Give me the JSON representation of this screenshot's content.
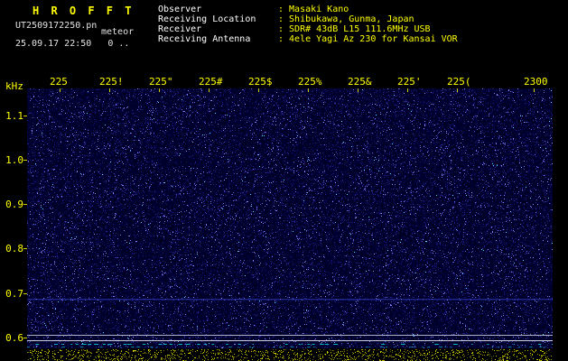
{
  "app": {
    "title": "H R O F F T"
  },
  "header": {
    "filename": "UT2509172250.pn",
    "station": "meteor",
    "datetime": "25.09.17 22:50   0 ..",
    "info_rows": [
      {
        "label": "Observer",
        "value": ": Masaki Kano"
      },
      {
        "label": "Receiving Location",
        "value": ": Shibukawa, Gunma, Japan"
      },
      {
        "label": "Receiver",
        "value": ": SDR# 43dB L15 111.6MHz USB"
      },
      {
        "label": "Receiving Antenna",
        "value": ": 4ele Yagi Az 230 for Kansai VOR"
      }
    ]
  },
  "chart_data": {
    "type": "heatmap",
    "subtype": "radio spectrogram (HROFFT meteor radio observation output)",
    "title": "10-minute meteor echo spectrogram",
    "time_span": "22:50 - 23:00 UT, 25.09.17",
    "x_axis": {
      "unit": "UT time (hhmm)",
      "tick_labels": [
        "225",
        "225!",
        "225\"",
        "225#",
        "225$",
        "225%",
        "225&",
        "225'",
        "225(",
        "2300"
      ]
    },
    "y_axis": {
      "unit": "kHz",
      "tick_labels": [
        "1.1",
        "1.0",
        "0.9",
        "0.8",
        "0.7",
        "0.6"
      ],
      "range_khz": [
        0.57,
        1.16
      ]
    },
    "content": "uniform dark-blue random background noise, no strong meteor echo traces",
    "features": [
      {
        "freq_khz": 0.69,
        "appearance": "faint blue continuous carrier line"
      },
      {
        "freq_khz": 0.61,
        "appearance": "thin pale horizontal line across full width"
      },
      {
        "freq_khz": 0.6,
        "appearance": "thin pale horizontal line across full width"
      },
      {
        "freq_khz": 0.58,
        "appearance": "intermittent cyan dashed line"
      }
    ],
    "bottom_strip": "yellow speckled signal-level noise band along the bottom edge"
  },
  "colors": {
    "background": "#000000",
    "accent_yellow": "#ffff00",
    "text_white": "#ffffff",
    "noise_blue": "#1a1acc",
    "cyan": "#00e5e5"
  }
}
